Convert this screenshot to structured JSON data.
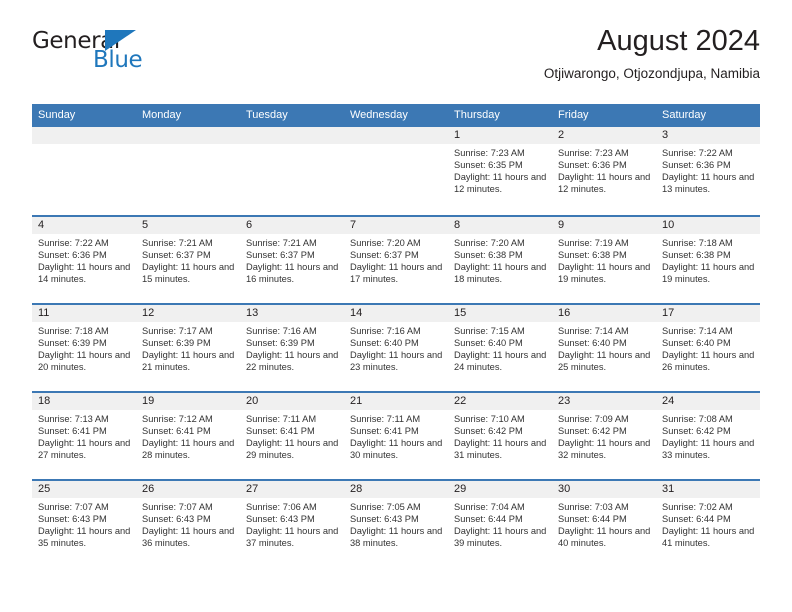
{
  "branding": {
    "logo_text_primary": "General",
    "logo_text_secondary": "Blue",
    "logo_accent_color": "#1f77bc"
  },
  "header": {
    "title": "August 2024",
    "subtitle": "Otjiwarongo, Otjozondjupa, Namibia"
  },
  "theme": {
    "header_bg": "#3c78b4",
    "day_band_bg": "#f0f0f0",
    "text_color": "#231f20"
  },
  "weekdays": [
    "Sunday",
    "Monday",
    "Tuesday",
    "Wednesday",
    "Thursday",
    "Friday",
    "Saturday"
  ],
  "weeks": [
    [
      {
        "day": "",
        "empty": true
      },
      {
        "day": "",
        "empty": true
      },
      {
        "day": "",
        "empty": true
      },
      {
        "day": "",
        "empty": true
      },
      {
        "day": "1",
        "sunrise": "Sunrise: 7:23 AM",
        "sunset": "Sunset: 6:35 PM",
        "daylight": "Daylight: 11 hours and 12 minutes."
      },
      {
        "day": "2",
        "sunrise": "Sunrise: 7:23 AM",
        "sunset": "Sunset: 6:36 PM",
        "daylight": "Daylight: 11 hours and 12 minutes."
      },
      {
        "day": "3",
        "sunrise": "Sunrise: 7:22 AM",
        "sunset": "Sunset: 6:36 PM",
        "daylight": "Daylight: 11 hours and 13 minutes."
      }
    ],
    [
      {
        "day": "4",
        "sunrise": "Sunrise: 7:22 AM",
        "sunset": "Sunset: 6:36 PM",
        "daylight": "Daylight: 11 hours and 14 minutes."
      },
      {
        "day": "5",
        "sunrise": "Sunrise: 7:21 AM",
        "sunset": "Sunset: 6:37 PM",
        "daylight": "Daylight: 11 hours and 15 minutes."
      },
      {
        "day": "6",
        "sunrise": "Sunrise: 7:21 AM",
        "sunset": "Sunset: 6:37 PM",
        "daylight": "Daylight: 11 hours and 16 minutes."
      },
      {
        "day": "7",
        "sunrise": "Sunrise: 7:20 AM",
        "sunset": "Sunset: 6:37 PM",
        "daylight": "Daylight: 11 hours and 17 minutes."
      },
      {
        "day": "8",
        "sunrise": "Sunrise: 7:20 AM",
        "sunset": "Sunset: 6:38 PM",
        "daylight": "Daylight: 11 hours and 18 minutes."
      },
      {
        "day": "9",
        "sunrise": "Sunrise: 7:19 AM",
        "sunset": "Sunset: 6:38 PM",
        "daylight": "Daylight: 11 hours and 19 minutes."
      },
      {
        "day": "10",
        "sunrise": "Sunrise: 7:18 AM",
        "sunset": "Sunset: 6:38 PM",
        "daylight": "Daylight: 11 hours and 19 minutes."
      }
    ],
    [
      {
        "day": "11",
        "sunrise": "Sunrise: 7:18 AM",
        "sunset": "Sunset: 6:39 PM",
        "daylight": "Daylight: 11 hours and 20 minutes."
      },
      {
        "day": "12",
        "sunrise": "Sunrise: 7:17 AM",
        "sunset": "Sunset: 6:39 PM",
        "daylight": "Daylight: 11 hours and 21 minutes."
      },
      {
        "day": "13",
        "sunrise": "Sunrise: 7:16 AM",
        "sunset": "Sunset: 6:39 PM",
        "daylight": "Daylight: 11 hours and 22 minutes."
      },
      {
        "day": "14",
        "sunrise": "Sunrise: 7:16 AM",
        "sunset": "Sunset: 6:40 PM",
        "daylight": "Daylight: 11 hours and 23 minutes."
      },
      {
        "day": "15",
        "sunrise": "Sunrise: 7:15 AM",
        "sunset": "Sunset: 6:40 PM",
        "daylight": "Daylight: 11 hours and 24 minutes."
      },
      {
        "day": "16",
        "sunrise": "Sunrise: 7:14 AM",
        "sunset": "Sunset: 6:40 PM",
        "daylight": "Daylight: 11 hours and 25 minutes."
      },
      {
        "day": "17",
        "sunrise": "Sunrise: 7:14 AM",
        "sunset": "Sunset: 6:40 PM",
        "daylight": "Daylight: 11 hours and 26 minutes."
      }
    ],
    [
      {
        "day": "18",
        "sunrise": "Sunrise: 7:13 AM",
        "sunset": "Sunset: 6:41 PM",
        "daylight": "Daylight: 11 hours and 27 minutes."
      },
      {
        "day": "19",
        "sunrise": "Sunrise: 7:12 AM",
        "sunset": "Sunset: 6:41 PM",
        "daylight": "Daylight: 11 hours and 28 minutes."
      },
      {
        "day": "20",
        "sunrise": "Sunrise: 7:11 AM",
        "sunset": "Sunset: 6:41 PM",
        "daylight": "Daylight: 11 hours and 29 minutes."
      },
      {
        "day": "21",
        "sunrise": "Sunrise: 7:11 AM",
        "sunset": "Sunset: 6:41 PM",
        "daylight": "Daylight: 11 hours and 30 minutes."
      },
      {
        "day": "22",
        "sunrise": "Sunrise: 7:10 AM",
        "sunset": "Sunset: 6:42 PM",
        "daylight": "Daylight: 11 hours and 31 minutes."
      },
      {
        "day": "23",
        "sunrise": "Sunrise: 7:09 AM",
        "sunset": "Sunset: 6:42 PM",
        "daylight": "Daylight: 11 hours and 32 minutes."
      },
      {
        "day": "24",
        "sunrise": "Sunrise: 7:08 AM",
        "sunset": "Sunset: 6:42 PM",
        "daylight": "Daylight: 11 hours and 33 minutes."
      }
    ],
    [
      {
        "day": "25",
        "sunrise": "Sunrise: 7:07 AM",
        "sunset": "Sunset: 6:43 PM",
        "daylight": "Daylight: 11 hours and 35 minutes."
      },
      {
        "day": "26",
        "sunrise": "Sunrise: 7:07 AM",
        "sunset": "Sunset: 6:43 PM",
        "daylight": "Daylight: 11 hours and 36 minutes."
      },
      {
        "day": "27",
        "sunrise": "Sunrise: 7:06 AM",
        "sunset": "Sunset: 6:43 PM",
        "daylight": "Daylight: 11 hours and 37 minutes."
      },
      {
        "day": "28",
        "sunrise": "Sunrise: 7:05 AM",
        "sunset": "Sunset: 6:43 PM",
        "daylight": "Daylight: 11 hours and 38 minutes."
      },
      {
        "day": "29",
        "sunrise": "Sunrise: 7:04 AM",
        "sunset": "Sunset: 6:44 PM",
        "daylight": "Daylight: 11 hours and 39 minutes."
      },
      {
        "day": "30",
        "sunrise": "Sunrise: 7:03 AM",
        "sunset": "Sunset: 6:44 PM",
        "daylight": "Daylight: 11 hours and 40 minutes."
      },
      {
        "day": "31",
        "sunrise": "Sunrise: 7:02 AM",
        "sunset": "Sunset: 6:44 PM",
        "daylight": "Daylight: 11 hours and 41 minutes."
      }
    ]
  ]
}
